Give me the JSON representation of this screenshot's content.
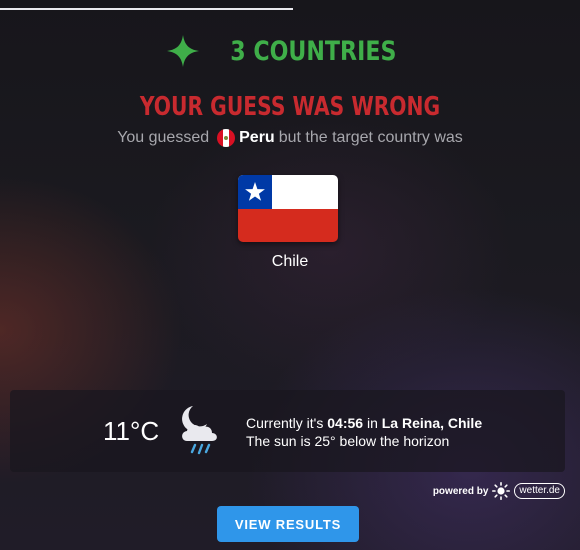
{
  "header": {
    "countries_label": "3 Countries",
    "accent_color": "#3fae49"
  },
  "result": {
    "title": "Your guess was wrong",
    "title_color": "#c82a2f",
    "guess_prefix": "You guessed",
    "guessed_country": "Peru",
    "guess_suffix": "but the target country was",
    "target_country": "Chile",
    "guessed_flag_icon": "peru-flag-icon",
    "target_flag_icon": "chile-flag-icon"
  },
  "weather": {
    "temperature": "11°C",
    "icon": "night-rain-icon",
    "currently_prefix": "Currently it's",
    "time": "04:56",
    "location_prefix": "in",
    "location": "La Reina, Chile",
    "sun_info": "The sun is 25° below the horizon"
  },
  "attribution": {
    "powered_by": "powered by",
    "provider": "wetter.de"
  },
  "actions": {
    "view_results": "View results",
    "button_color": "#2f96ea"
  }
}
